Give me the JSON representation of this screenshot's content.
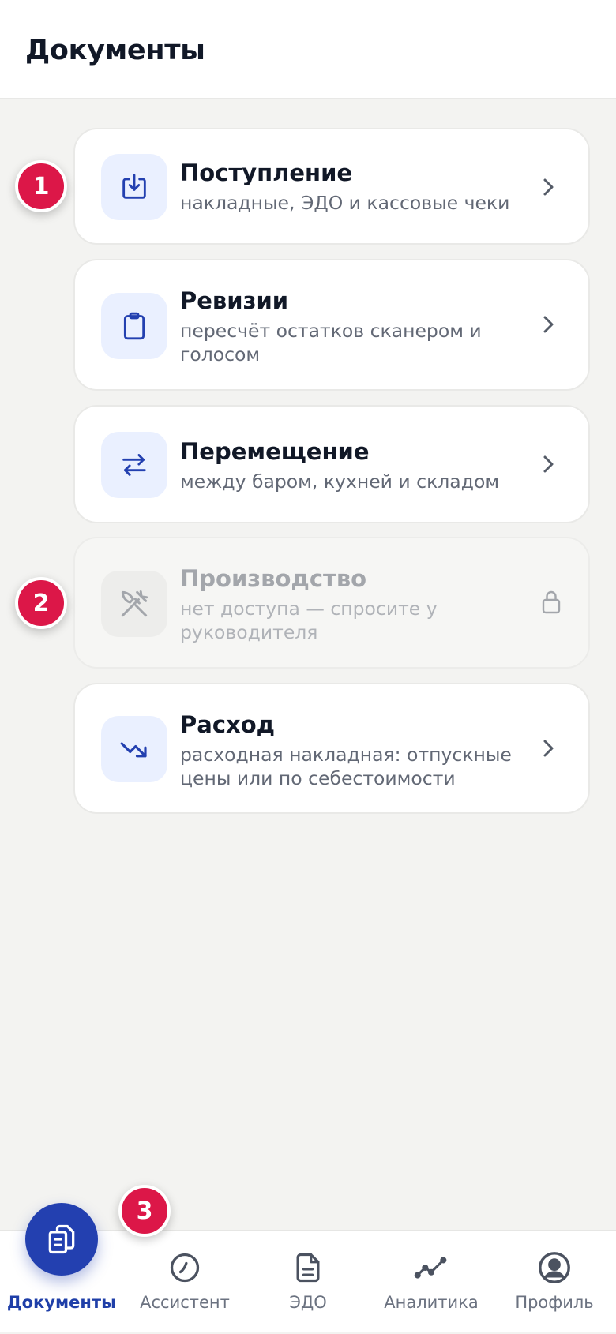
{
  "header": {
    "title": "Документы"
  },
  "cards": [
    {
      "title": "Поступление",
      "subtitle": "накладные, ЭДО и кассовые чеки",
      "icon": "download-icon",
      "enabled": true
    },
    {
      "title": "Ревизии",
      "subtitle": "пересчёт остатков сканером и голосом",
      "icon": "clipboard-icon",
      "enabled": true
    },
    {
      "title": "Перемещение",
      "subtitle": "между баром, кухней и складом",
      "icon": "transfer-arrows-icon",
      "enabled": true
    },
    {
      "title": "Производство",
      "subtitle": "нет доступа — спросите у руководителя",
      "icon": "utensils-icon",
      "enabled": false
    },
    {
      "title": "Расход",
      "subtitle": "расходная накладная: отпускные цены или по себестоимости",
      "icon": "trend-down-icon",
      "enabled": true
    }
  ],
  "badges": [
    "1",
    "2",
    "3"
  ],
  "tabbar": {
    "items": [
      {
        "label": "Документы",
        "icon": "documents-icon",
        "active": true
      },
      {
        "label": "Ассистент",
        "icon": "assistant-icon",
        "active": false
      },
      {
        "label": "ЭДО",
        "icon": "file-icon",
        "active": false
      },
      {
        "label": "Аналитика",
        "icon": "analytics-icon",
        "active": false
      },
      {
        "label": "Профиль",
        "icon": "profile-icon",
        "active": false
      }
    ]
  },
  "colors": {
    "accent": "#2340b0",
    "badge": "#dc1748",
    "background": "#f3f3f1"
  }
}
